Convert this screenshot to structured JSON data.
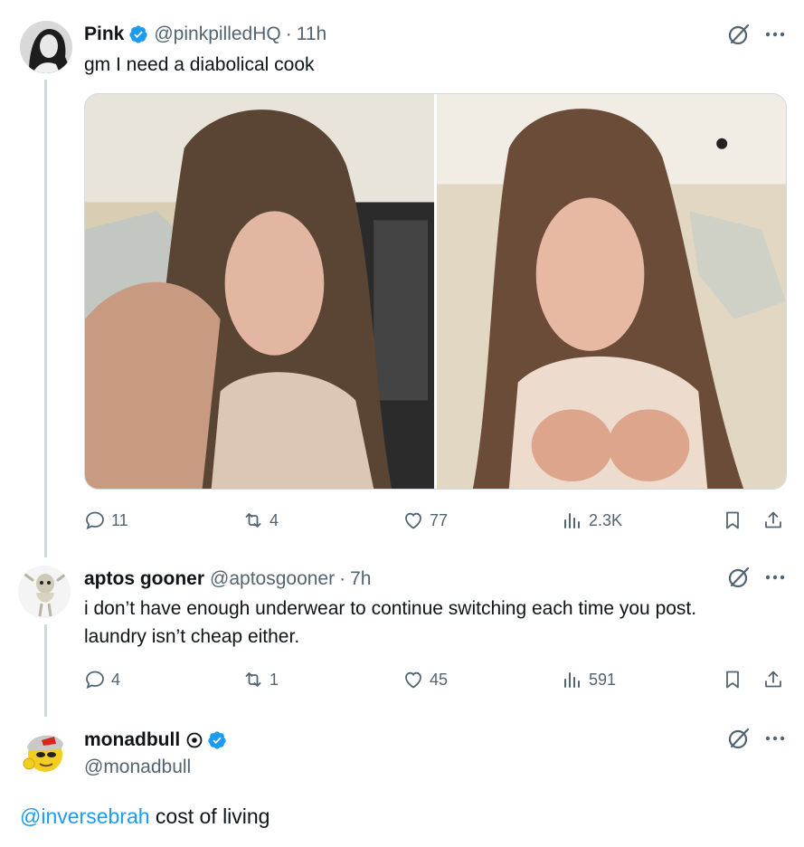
{
  "tweets": [
    {
      "name": "Pink",
      "handle": "@pinkpilledHQ",
      "separator": "·",
      "time": "11h",
      "text": "gm I need a diabolical cook",
      "replies": "11",
      "reposts": "4",
      "likes": "77",
      "views": "2.3K"
    },
    {
      "name": "aptos gooner",
      "handle": "@aptosgooner",
      "separator": "·",
      "time": "7h",
      "text_line1": "i don’t have enough underwear to continue switching each time you post.",
      "text_line2": "laundry isn’t cheap either.",
      "replies": "4",
      "reposts": "1",
      "likes": "45",
      "views": "591"
    },
    {
      "name": "monadbull",
      "handle": "@monadbull",
      "mention": "@inversebrah",
      "text": " cost of living"
    }
  ],
  "colors": {
    "verified": "#1d9bf0",
    "link": "#1d9bf0",
    "muted": "#536471",
    "text": "#0f1419",
    "thread_line": "#cfd9de"
  },
  "icons": [
    "verified-badge-icon",
    "grok-icon",
    "more-icon",
    "reply-icon",
    "repost-icon",
    "like-icon",
    "views-icon",
    "bookmark-icon",
    "share-icon",
    "circle-dot-badge-icon"
  ]
}
